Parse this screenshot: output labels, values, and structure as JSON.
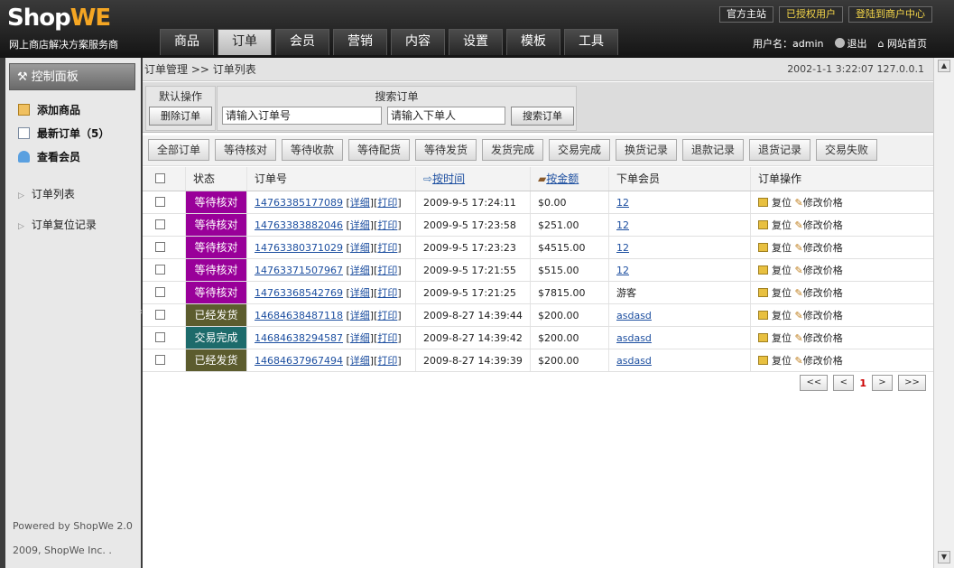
{
  "brand": {
    "logo_a": "Shop",
    "logo_b": "WE",
    "slogan": "网上商店解决方案服务商"
  },
  "toplinks": [
    "官方主站",
    "已授权用户",
    "登陆到商户中心"
  ],
  "nav": [
    "商品",
    "订单",
    "会员",
    "营销",
    "内容",
    "设置",
    "模板",
    "工具"
  ],
  "userbar": {
    "username": "用户名：admin",
    "logout": "退出",
    "home": "网站首页"
  },
  "sidebar": {
    "control_panel": "控制面板",
    "quick": [
      "添加商品",
      "最新订单（5）",
      "查看会员"
    ],
    "links": [
      "订单列表",
      "订单复位记录"
    ],
    "powered": "Powered by ShopWe 2.0",
    "copyright": "2009, ShopWe Inc. ."
  },
  "breadcrumb": "订单管理 >> 订单列表",
  "sysinfo": "2002-1-1 3:22:07 127.0.0.1",
  "ops": {
    "default_title": "默认操作",
    "delete_btn": "删除订单",
    "search_title": "搜索订单",
    "order_no_placeholder": "请输入订单号",
    "buyer_placeholder": "请输入下单人",
    "search_btn": "搜索订单"
  },
  "filters": [
    "全部订单",
    "等待核对",
    "等待收款",
    "等待配货",
    "等待发货",
    "发货完成",
    "交易完成",
    "换货记录",
    "退款记录",
    "退货记录",
    "交易失败"
  ],
  "table": {
    "headers": {
      "status": "状态",
      "order_no": "订单号",
      "time": "按时间",
      "amount": "按金额",
      "member": "下单会员",
      "ops": "订单操作"
    },
    "detail": "详细",
    "print": "打印",
    "reset": "复位",
    "edit_price": "修改价格",
    "rows": [
      {
        "status": "等待核对",
        "color": "#990099",
        "order_no": "14763385177089",
        "time": "2009-9-5 17:24:11",
        "amount": "$0.00",
        "member": "12",
        "member_link": true
      },
      {
        "status": "等待核对",
        "color": "#990099",
        "order_no": "14763383882046",
        "time": "2009-9-5 17:23:58",
        "amount": "$251.00",
        "member": "12",
        "member_link": true
      },
      {
        "status": "等待核对",
        "color": "#990099",
        "order_no": "14763380371029",
        "time": "2009-9-5 17:23:23",
        "amount": "$4515.00",
        "member": "12",
        "member_link": true
      },
      {
        "status": "等待核对",
        "color": "#990099",
        "order_no": "14763371507967",
        "time": "2009-9-5 17:21:55",
        "amount": "$515.00",
        "member": "12",
        "member_link": true
      },
      {
        "status": "等待核对",
        "color": "#990099",
        "order_no": "14763368542769",
        "time": "2009-9-5 17:21:25",
        "amount": "$7815.00",
        "member": "游客",
        "member_link": false
      },
      {
        "status": "已经发货",
        "color": "#5c5c2e",
        "order_no": "14684638487118",
        "time": "2009-8-27 14:39:44",
        "amount": "$200.00",
        "member": "asdasd",
        "member_link": true
      },
      {
        "status": "交易完成",
        "color": "#1d6b6b",
        "order_no": "14684638294587",
        "time": "2009-8-27 14:39:42",
        "amount": "$200.00",
        "member": "asdasd",
        "member_link": true
      },
      {
        "status": "已经发货",
        "color": "#5c5c2e",
        "order_no": "14684637967494",
        "time": "2009-8-27 14:39:39",
        "amount": "$200.00",
        "member": "asdasd",
        "member_link": true
      }
    ]
  },
  "pager": {
    "first": "<<",
    "prev": "<",
    "current": "1",
    "next": ">",
    "last": ">>"
  }
}
